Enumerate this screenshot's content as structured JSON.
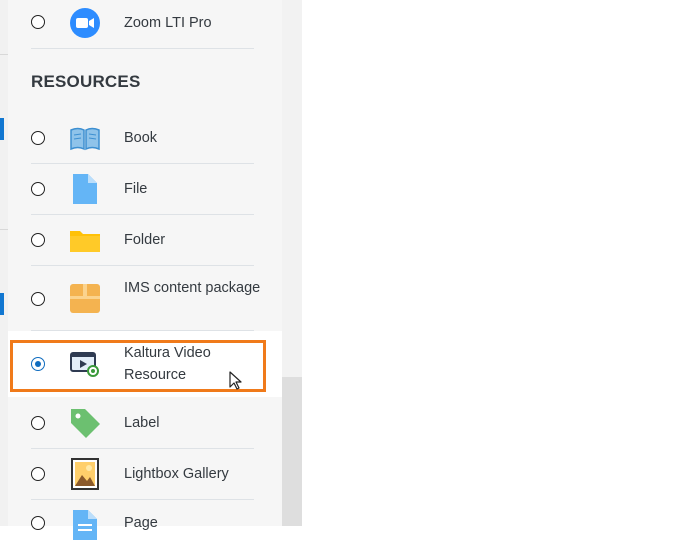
{
  "chooser": {
    "activities_tail": [
      {
        "label": "Zoom LTI Pro",
        "icon": "zoom-icon",
        "selected": false
      }
    ],
    "resources_title": "RESOURCES",
    "resources": [
      {
        "label": "Book",
        "icon": "book-icon",
        "selected": false
      },
      {
        "label": "File",
        "icon": "file-icon",
        "selected": false
      },
      {
        "label": "Folder",
        "icon": "folder-icon",
        "selected": false
      },
      {
        "label": "IMS content package",
        "icon": "package-icon",
        "selected": false
      },
      {
        "label": "Kaltura Video Resource",
        "icon": "kaltura-video-icon",
        "selected": true
      },
      {
        "label": "Label",
        "icon": "label-tag-icon",
        "selected": false
      },
      {
        "label": "Lightbox Gallery",
        "icon": "gallery-image-icon",
        "selected": false
      },
      {
        "label": "Page",
        "icon": "page-icon",
        "selected": false
      }
    ]
  },
  "colors": {
    "highlight_border": "#f07a1a",
    "radio_selected": "#0f6cbf",
    "zoom_blue": "#2D8CFF",
    "file_blue": "#64b5f6",
    "folder_yellow": "#ffc107",
    "package_orange": "#f4b350",
    "label_green": "#6cc070"
  }
}
